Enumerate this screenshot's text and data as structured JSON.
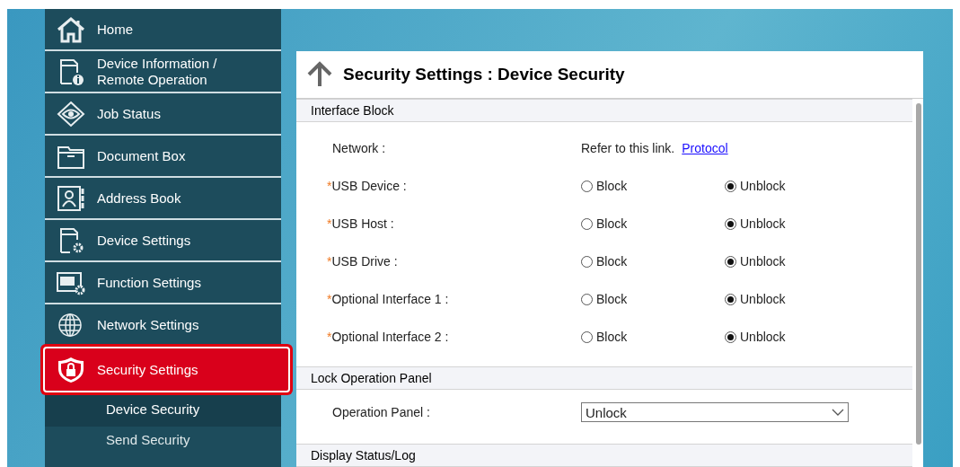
{
  "sidebar": {
    "items": [
      {
        "label": "Home",
        "selected": false
      },
      {
        "label": "Device Information /\nRemote Operation",
        "selected": false
      },
      {
        "label": "Job Status",
        "selected": false
      },
      {
        "label": "Document Box",
        "selected": false
      },
      {
        "label": "Address Book",
        "selected": false
      },
      {
        "label": "Device Settings",
        "selected": false
      },
      {
        "label": "Function Settings",
        "selected": false
      },
      {
        "label": "Network Settings",
        "selected": false
      },
      {
        "label": "Security Settings",
        "selected": true
      }
    ],
    "sub_items": [
      {
        "label": "Device Security",
        "selected": true
      },
      {
        "label": "Send Security",
        "selected": false
      }
    ]
  },
  "content": {
    "title": "Security Settings : Device Security",
    "sections": [
      {
        "heading": "Interface Block",
        "rows": [
          {
            "kind": "link",
            "label": "Network :",
            "text": "Refer to this link.",
            "link": "Protocol"
          },
          {
            "kind": "radio",
            "mark": "*",
            "label": "USB Device :",
            "options": [
              {
                "label": "Block",
                "selected": false
              },
              {
                "label": "Unblock",
                "selected": true
              }
            ]
          },
          {
            "kind": "radio",
            "mark": "*",
            "label": "USB Host :",
            "options": [
              {
                "label": "Block",
                "selected": false
              },
              {
                "label": "Unblock",
                "selected": true
              }
            ]
          },
          {
            "kind": "radio",
            "mark": "*",
            "label": "USB Drive :",
            "options": [
              {
                "label": "Block",
                "selected": false
              },
              {
                "label": "Unblock",
                "selected": true
              }
            ]
          },
          {
            "kind": "radio",
            "mark": "*",
            "label": "Optional Interface 1 :",
            "options": [
              {
                "label": "Block",
                "selected": false
              },
              {
                "label": "Unblock",
                "selected": true
              }
            ]
          },
          {
            "kind": "radio",
            "mark": "*",
            "label": "Optional Interface 2 :",
            "options": [
              {
                "label": "Block",
                "selected": false
              },
              {
                "label": "Unblock",
                "selected": true
              }
            ]
          }
        ]
      },
      {
        "heading": "Lock Operation Panel",
        "rows": [
          {
            "kind": "select",
            "label": "Operation Panel :",
            "value": "Unlock"
          }
        ]
      },
      {
        "heading": "Display Status/Log"
      }
    ]
  }
}
